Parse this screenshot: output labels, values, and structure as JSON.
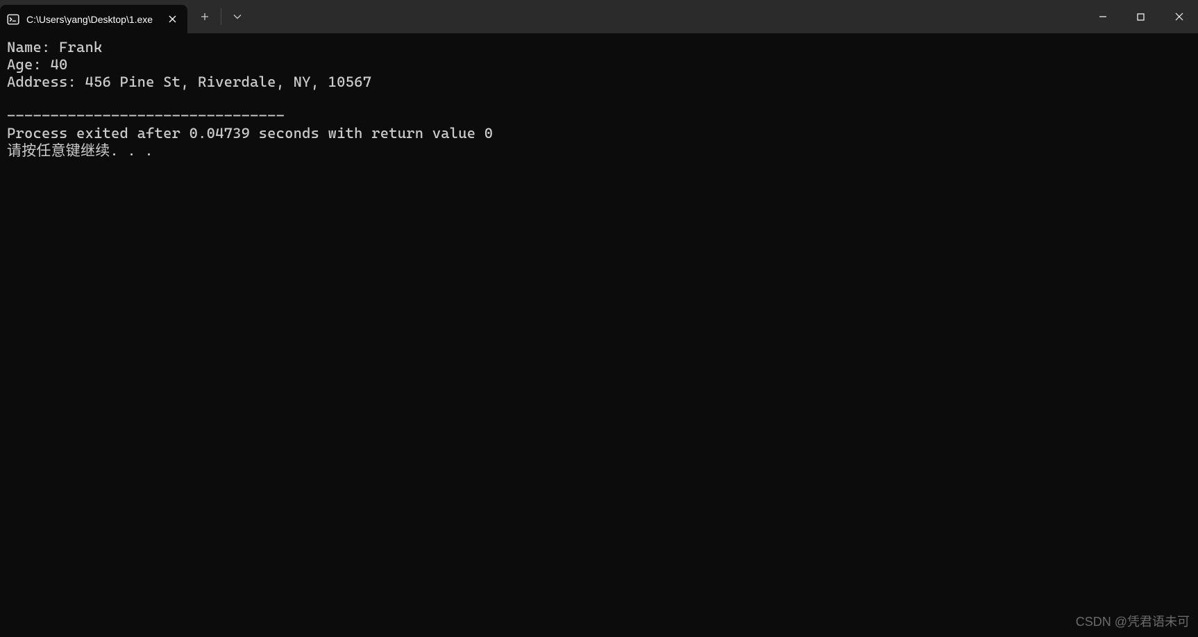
{
  "titlebar": {
    "tab_title": "C:\\Users\\yang\\Desktop\\1.exe"
  },
  "terminal": {
    "line1": "Name: Frank",
    "line2": "Age: 40",
    "line3": "Address: 456 Pine St, Riverdale, NY, 10567",
    "blank": "",
    "separator": "--------------------------------",
    "exit_msg": "Process exited after 0.04739 seconds with return value 0",
    "prompt": "请按任意键继续. . ."
  },
  "watermark": "CSDN @凭君语未可"
}
